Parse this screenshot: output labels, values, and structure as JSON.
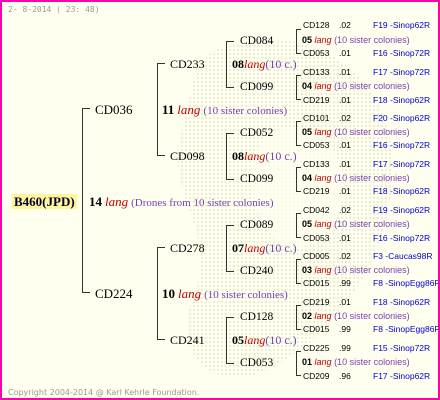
{
  "header": {
    "date": "2-  8-2014 ( 23: 48)"
  },
  "footer": {
    "copyright": "Copyright 2004-2014 @ Karl Kehrle Foundation."
  },
  "root": {
    "id": "B460(JPD)",
    "num": "14",
    "lang": "lang",
    "sisters": "(Drones from 10 sister colonies)"
  },
  "gen1": [
    {
      "cd": "CD036",
      "num": "11",
      "lang": "lang",
      "sisters": "(10 sister colonies)"
    },
    {
      "cd": "CD224",
      "num": "10",
      "lang": "lang",
      "sisters": "(10 sister colonies)"
    }
  ],
  "gen2": [
    {
      "cd": "CD233",
      "num": "08",
      "lang": "lang",
      "sisters": "(10 c.)"
    },
    {
      "cd": "CD098",
      "num": "08",
      "lang": "lang",
      "sisters": "(10 c.)"
    },
    {
      "cd": "CD278",
      "num": "07",
      "lang": "lang",
      "sisters": "(10 c.)"
    },
    {
      "cd": "CD241",
      "num": "05",
      "lang": "lang",
      "sisters": "(10 c.)"
    }
  ],
  "gen3": [
    {
      "cd": "CD084",
      "num": "05",
      "lang": "lang",
      "sisters": "(10 sister colonies)"
    },
    {
      "cd": "CD099",
      "num": "04",
      "lang": "lang",
      "sisters": "(10 sister colonies)"
    },
    {
      "cd": "CD052",
      "num": "05",
      "lang": "lang",
      "sisters": "(10 sister colonies)"
    },
    {
      "cd": "CD099",
      "num": "04",
      "lang": "lang",
      "sisters": "(10 sister colonies)"
    },
    {
      "cd": "CD089",
      "num": "05",
      "lang": "lang",
      "sisters": "(10 sister colonies)"
    },
    {
      "cd": "CD240",
      "num": "03",
      "lang": "lang",
      "sisters": "(10 sister colonies)"
    },
    {
      "cd": "CD128",
      "num": "02",
      "lang": "lang",
      "sisters": "(10 sister colonies)"
    },
    {
      "cd": "CD053",
      "num": "01",
      "lang": "lang",
      "sisters": "(10 sister colonies)"
    }
  ],
  "leaves": [
    {
      "cd": "CD128",
      "yr": ".02",
      "ref": "F19 -Sinop62R"
    },
    {
      "cd": "CD053",
      "yr": ".01",
      "ref": "F16 -Sinop72R"
    },
    {
      "cd": "CD133",
      "yr": ".01",
      "ref": "F17 -Sinop72R"
    },
    {
      "cd": "CD219",
      "yr": ".01",
      "ref": "F18 -Sinop62R"
    },
    {
      "cd": "CD101",
      "yr": ".02",
      "ref": "F20 -Sinop62R"
    },
    {
      "cd": "CD053",
      "yr": ".01",
      "ref": "F16 -Sinop72R"
    },
    {
      "cd": "CD133",
      "yr": ".01",
      "ref": "F17 -Sinop72R"
    },
    {
      "cd": "CD219",
      "yr": ".01",
      "ref": "F18 -Sinop62R"
    },
    {
      "cd": "CD042",
      "yr": ".02",
      "ref": "F19 -Sinop62R"
    },
    {
      "cd": "CD053",
      "yr": ".01",
      "ref": "F16 -Sinop72R"
    },
    {
      "cd": "CD005",
      "yr": ".02",
      "ref": "F3 -Caucas98R"
    },
    {
      "cd": "CD015",
      "yr": ".99",
      "ref": "F8 -SinopEgg86R"
    },
    {
      "cd": "CD219",
      "yr": ".01",
      "ref": "F18 -Sinop62R"
    },
    {
      "cd": "CD015",
      "yr": ".99",
      "ref": "F8 -SinopEgg86R"
    },
    {
      "cd": "CD225",
      "yr": ".99",
      "ref": "F15 -Sinop72R"
    },
    {
      "cd": "CD209",
      "yr": ".96",
      "ref": "F17 -Sinop62R"
    }
  ]
}
